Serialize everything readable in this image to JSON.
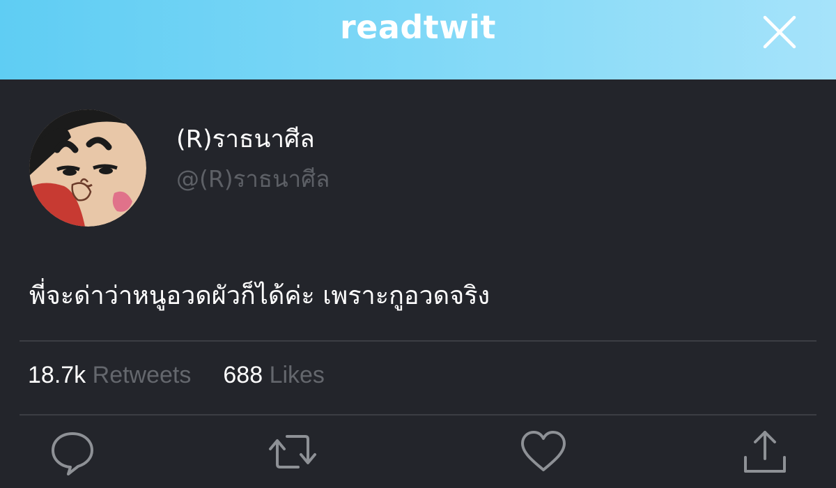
{
  "app": {
    "brand": "readtwit",
    "close_icon": "close-icon"
  },
  "tweet": {
    "display_name": "(R)ราธนาศีล",
    "handle": "@(R)ราธนาศีล",
    "text": "พี่จะด่าว่าหนูอวดผัวก็ได้ค่ะ เพราะกูอวดจริง",
    "avatar_icon": "cartoon-avatar"
  },
  "stats": {
    "retweets_count": "18.7k",
    "retweets_label": "Retweets",
    "likes_count": "688",
    "likes_label": "Likes"
  },
  "actions": {
    "reply_icon": "reply-icon",
    "retweet_icon": "retweet-icon",
    "like_icon": "heart-icon",
    "share_icon": "share-icon"
  },
  "colors": {
    "header_gradient_start": "#5fcdf3",
    "header_gradient_end": "#a6e3fa",
    "background": "#23252b",
    "muted_text": "#64676d",
    "divider": "#3c3e44"
  }
}
